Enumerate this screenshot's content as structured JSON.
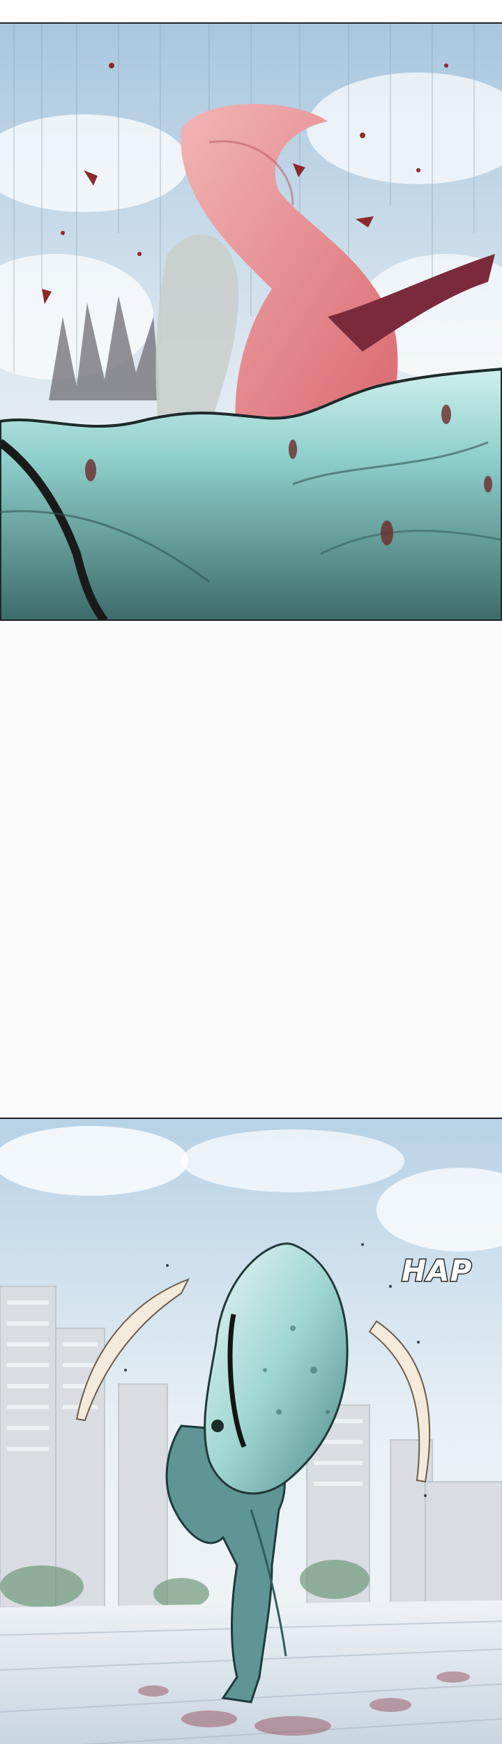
{
  "sound_effect": "HAP",
  "panels": [
    {
      "id": "panel-1",
      "content": "impact"
    },
    {
      "id": "panel-2",
      "content": "creature-standing"
    }
  ],
  "colors": {
    "sky": "#bcd6ea",
    "creature_teal": "#7fc7c2",
    "creature_dark": "#3e6f6d",
    "tongue_pink": "#e7888f",
    "blood": "#8a2a2a",
    "floor": "#dde6ee"
  }
}
